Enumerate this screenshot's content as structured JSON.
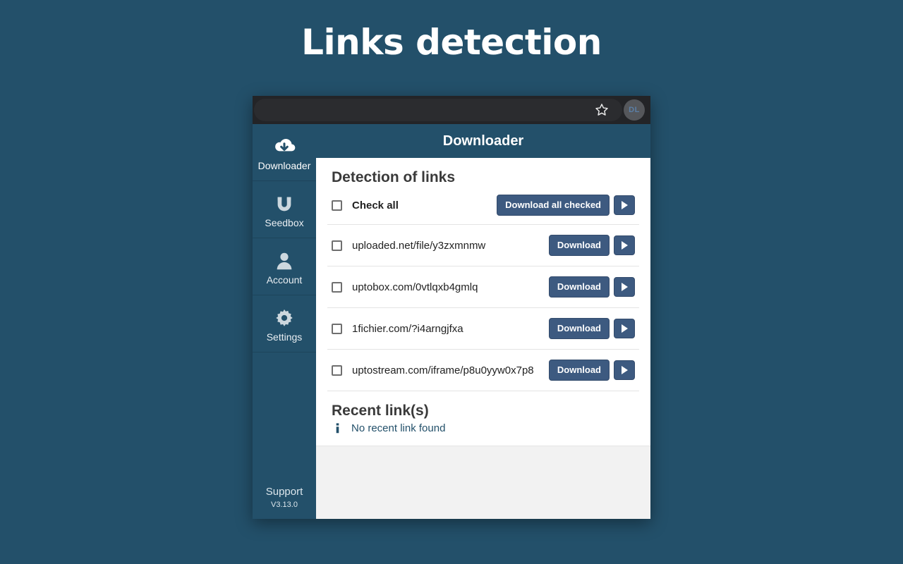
{
  "page": {
    "title": "Links detection",
    "background_color": "#23506a"
  },
  "browser": {
    "star_icon": "star-icon",
    "avatar_initials": "DL"
  },
  "app": {
    "header_title": "Downloader",
    "accent_color": "#23506a",
    "button_color": "#3d5a80"
  },
  "sidebar": {
    "items": [
      {
        "label": "Downloader",
        "icon": "cloud-download-icon",
        "active": true
      },
      {
        "label": "Seedbox",
        "icon": "magnet-icon",
        "active": false
      },
      {
        "label": "Account",
        "icon": "person-icon",
        "active": false
      },
      {
        "label": "Settings",
        "icon": "gear-icon",
        "active": false
      }
    ],
    "support_label": "Support",
    "version": "V3.13.0"
  },
  "detection": {
    "section_title": "Detection of links",
    "check_all_label": "Check all",
    "download_all_label": "Download all checked",
    "play_icon": "play-icon",
    "row_button_label": "Download",
    "links": [
      {
        "url": "uploaded.net/file/y3zxmnmw"
      },
      {
        "url": "uptobox.com/0vtlqxb4gmlq"
      },
      {
        "url": "1fichier.com/?i4arngjfxa"
      },
      {
        "url": "uptostream.com/iframe/p8u0yyw0x7p8"
      }
    ]
  },
  "recent": {
    "section_title": "Recent link(s)",
    "empty_message": "No recent link found",
    "info_icon": "info-icon"
  }
}
